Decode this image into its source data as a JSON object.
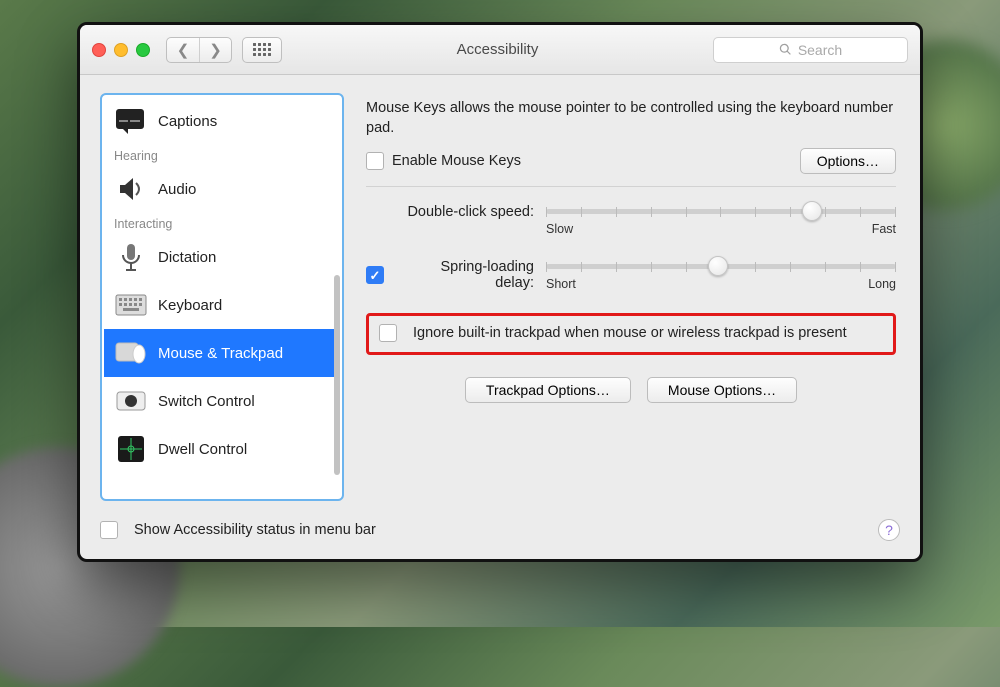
{
  "window": {
    "title": "Accessibility"
  },
  "search": {
    "placeholder": "Search"
  },
  "sidebar": {
    "headers": {
      "hearing": "Hearing",
      "interacting": "Interacting"
    },
    "items": {
      "captions": "Captions",
      "audio": "Audio",
      "dictation": "Dictation",
      "keyboard": "Keyboard",
      "mouse_trackpad": "Mouse & Trackpad",
      "switch_control": "Switch Control",
      "dwell_control": "Dwell Control"
    },
    "selected": "mouse_trackpad"
  },
  "panel": {
    "description": "Mouse Keys allows the mouse pointer to be controlled using the keyboard number pad.",
    "enable_mouse_keys": {
      "label": "Enable Mouse Keys",
      "checked": false
    },
    "options_button": "Options…",
    "double_click": {
      "label": "Double-click speed:",
      "min_label": "Slow",
      "max_label": "Fast",
      "value_pct": 76
    },
    "spring_loading": {
      "label": "Spring-loading delay:",
      "checked": true,
      "min_label": "Short",
      "max_label": "Long",
      "value_pct": 49
    },
    "ignore_trackpad": {
      "label": "Ignore built-in trackpad when mouse or wireless trackpad is present",
      "checked": false
    },
    "trackpad_options_button": "Trackpad Options…",
    "mouse_options_button": "Mouse Options…"
  },
  "footer": {
    "show_status_label": "Show Accessibility status in menu bar",
    "show_status_checked": false
  }
}
